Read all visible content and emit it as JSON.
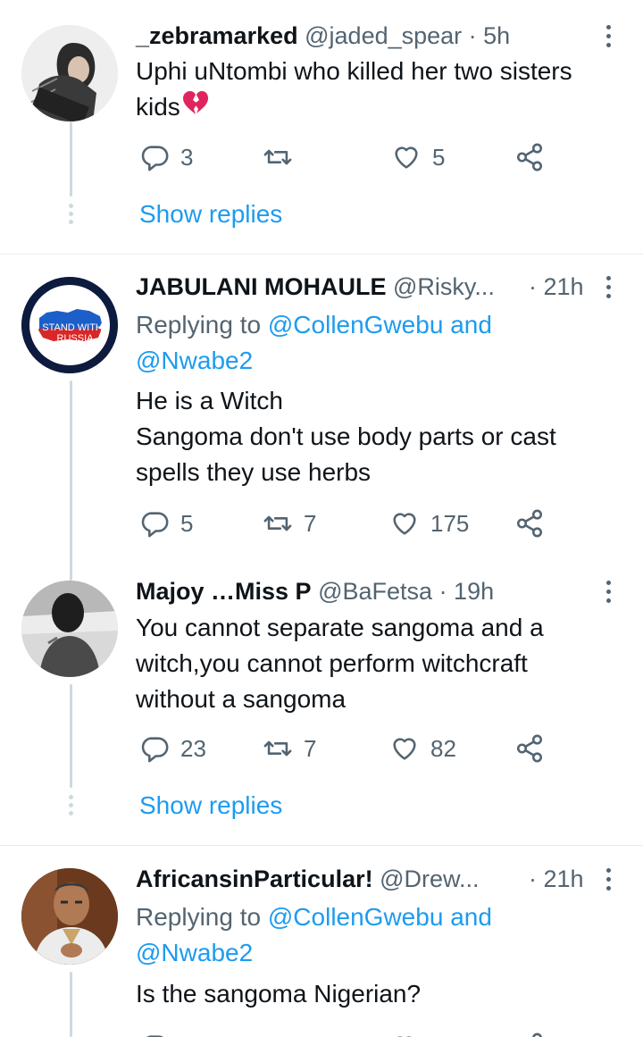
{
  "tweets": [
    {
      "name": "_zebramarked",
      "handle": "@jaded_spear",
      "time": "· 5h",
      "reply_prefix": "",
      "reply_mention1": "",
      "reply_and": "",
      "reply_mention2": "",
      "text_lines": [
        "Uphi uNtombi who killed her two sisters",
        "kids"
      ],
      "emoji": "broken-heart",
      "replies": "3",
      "retweets": "",
      "likes": "5",
      "show_replies": "Show replies"
    },
    {
      "name": "JABULANI MOHAULE",
      "handle": "@Risky...",
      "time": "· 21h",
      "reply_prefix": "Replying to",
      "reply_mention1": "@CollenGwebu",
      "reply_and": "and",
      "reply_mention2": "@Nwabe2",
      "text_lines": [
        "He is a Witch",
        "Sangoma don't use body parts or cast",
        "spells they use herbs"
      ],
      "replies": "5",
      "retweets": "7",
      "likes": "175",
      "avatar_text_1": "I STAND WITH",
      "avatar_text_2": "RUSSIA"
    },
    {
      "name": "Majoy …Miss P",
      "handle": "@BaFetsa",
      "time": "· 19h",
      "text_lines": [
        "You cannot separate sangoma and a",
        "witch,you cannot perform witchcraft",
        "without a sangoma"
      ],
      "replies": "23",
      "retweets": "7",
      "likes": "82",
      "show_replies": "Show replies"
    },
    {
      "name": "AfricansinParticular!",
      "handle": "@Drew...",
      "time": "· 21h",
      "reply_prefix": "Replying to",
      "reply_mention1": "@CollenGwebu",
      "reply_and": "and",
      "reply_mention2": "@Nwabe2",
      "text_lines": [
        "Is the sangoma Nigerian?"
      ]
    }
  ],
  "icons": {
    "reply": "reply-icon",
    "retweet": "retweet-icon",
    "like": "heart-icon",
    "share": "share-icon",
    "more": "more-options-icon"
  },
  "colors": {
    "link": "#1d9bf0",
    "secondary_text": "#536471",
    "thread_line": "#cfd9de",
    "broken_heart": "#e0245e"
  }
}
